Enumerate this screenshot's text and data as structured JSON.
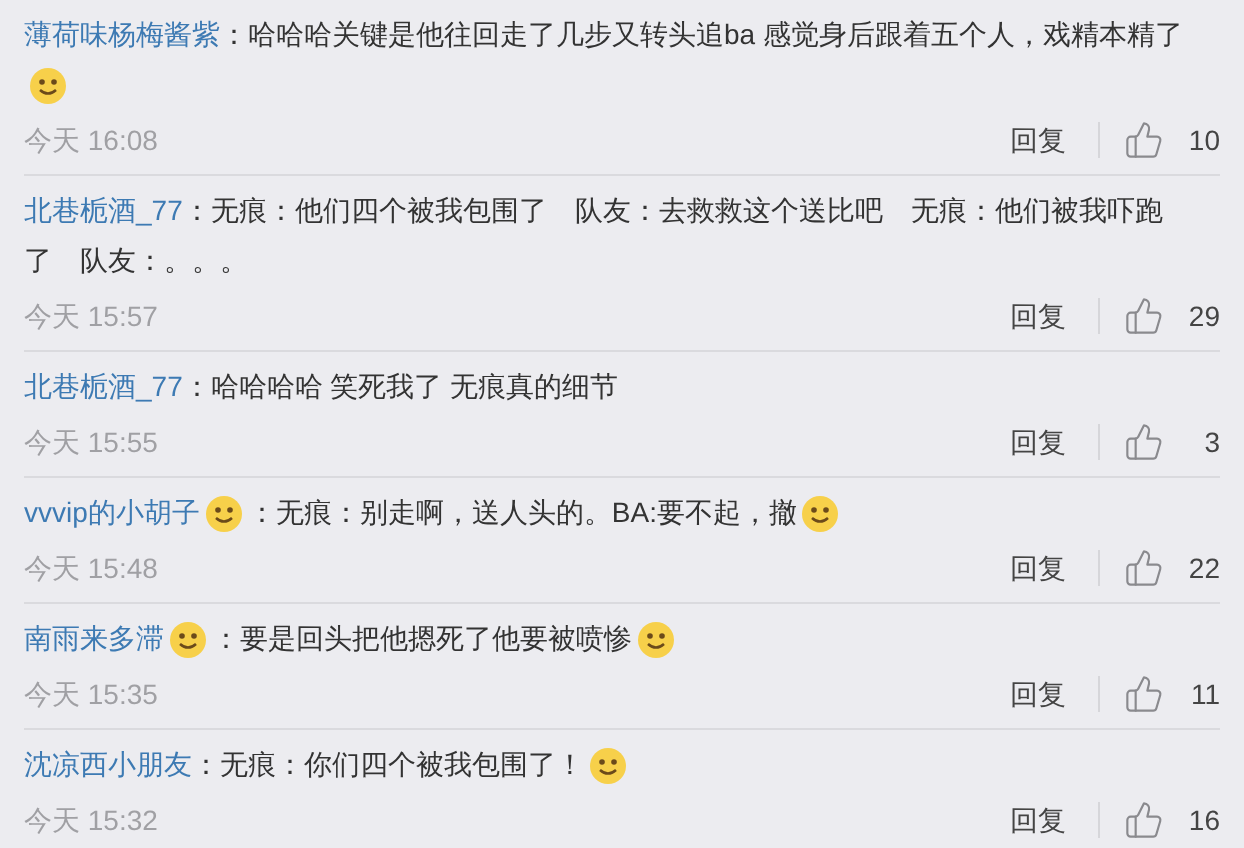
{
  "comments": [
    {
      "user": "薄荷味杨梅酱紫",
      "user_emoji": false,
      "content": [
        {
          "kind": "text",
          "text": "：哈哈哈关键是他往回走了几步又转头追ba 感觉身后跟着五个人，戏精本精了"
        },
        {
          "kind": "emoji"
        }
      ],
      "time": "今天 16:08",
      "reply": "回复",
      "likes": "10"
    },
    {
      "user": "北巷栀酒_77",
      "user_emoji": false,
      "content": [
        {
          "kind": "text",
          "text": "：无痕：他们四个被我包围了　队友：去救救这个送比吧　无痕：他们被我吓跑了　队友：。。。"
        }
      ],
      "time": "今天 15:57",
      "reply": "回复",
      "likes": "29"
    },
    {
      "user": "北巷栀酒_77",
      "user_emoji": false,
      "content": [
        {
          "kind": "text",
          "text": "：哈哈哈哈 笑死我了 无痕真的细节"
        }
      ],
      "time": "今天 15:55",
      "reply": "回复",
      "likes": "3"
    },
    {
      "user": "vvvip的小胡子",
      "user_emoji": true,
      "content": [
        {
          "kind": "text",
          "text": "：无痕：别走啊，送人头的。BA:要不起，撤"
        },
        {
          "kind": "emoji"
        }
      ],
      "time": "今天 15:48",
      "reply": "回复",
      "likes": "22"
    },
    {
      "user": "南雨来多滞",
      "user_emoji": true,
      "content": [
        {
          "kind": "text",
          "text": "：要是回头把他摁死了他要被喷惨"
        },
        {
          "kind": "emoji"
        }
      ],
      "time": "今天 15:35",
      "reply": "回复",
      "likes": "11"
    },
    {
      "user": "沈凉西小朋友",
      "user_emoji": false,
      "content": [
        {
          "kind": "text",
          "text": "：无痕：你们四个被我包围了！"
        },
        {
          "kind": "emoji"
        }
      ],
      "time": "今天 15:32",
      "reply": "回复",
      "likes": "16"
    }
  ]
}
